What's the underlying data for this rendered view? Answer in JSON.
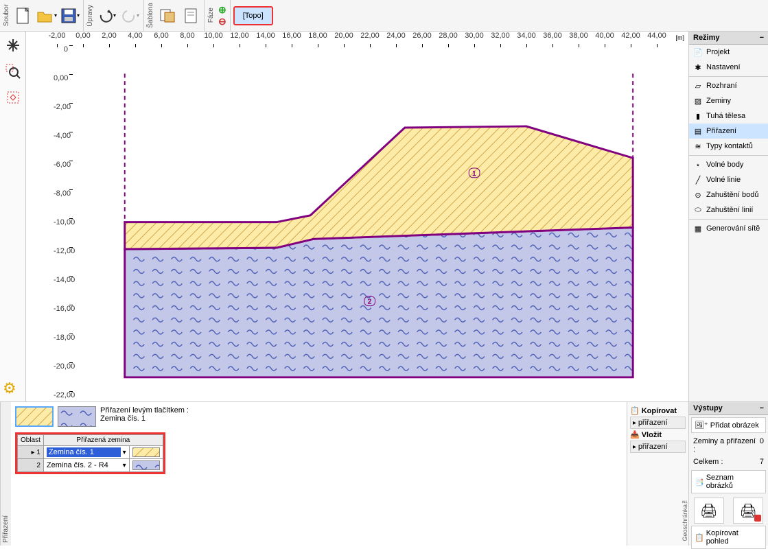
{
  "toolbar": {
    "labels": {
      "soubor": "Soubor",
      "upravy": "Úpravy",
      "sablona": "Šablona",
      "faze": "Fáze"
    },
    "topo": "[Topo]"
  },
  "ruler_unit": "[m]",
  "ruler_x": [
    "-2,00",
    "0,00",
    "2,00",
    "4,00",
    "6,00",
    "8,00",
    "10,00",
    "12,00",
    "14,00",
    "16,00",
    "18,00",
    "20,00",
    "22,00",
    "24,00",
    "26,00",
    "28,00",
    "30,00",
    "32,00",
    "34,00",
    "36,00",
    "38,00",
    "40,00",
    "42,00",
    "44,00"
  ],
  "ruler_y": [
    "0",
    "0,00",
    "-2,00",
    "-4,00",
    "-6,00",
    "-8,00",
    "-10,00",
    "-12,00",
    "-14,00",
    "-16,00",
    "-18,00",
    "-20,00",
    "-22,00"
  ],
  "region_labels": {
    "r1": "1",
    "r2": "2"
  },
  "right": {
    "header": "Režimy",
    "items": [
      {
        "label": "Projekt"
      },
      {
        "label": "Nastavení"
      },
      {
        "sep": true
      },
      {
        "label": "Rozhraní"
      },
      {
        "label": "Zeminy"
      },
      {
        "label": "Tuhá tělesa"
      },
      {
        "label": "Přiřazení",
        "active": true
      },
      {
        "label": "Typy kontaktů"
      },
      {
        "sep": true
      },
      {
        "label": "Volné body"
      },
      {
        "label": "Volné linie"
      },
      {
        "label": "Zahuštění bodů"
      },
      {
        "label": "Zahuštění linií"
      },
      {
        "sep": true
      },
      {
        "label": "Generování sítě"
      }
    ]
  },
  "bottom": {
    "panel_label": "Přiřazení",
    "hint_l1": "Přiřazení levým tlačítkem :",
    "hint_l2": "Zemina čís. 1",
    "th_oblast": "Oblast",
    "th_zemina": "Přiřazená zemina",
    "rows": [
      {
        "n": "1",
        "soil": "Zemina čís. 1",
        "sel": true
      },
      {
        "n": "2",
        "soil": "Zemina čís. 2 - R4",
        "sel": false
      }
    ]
  },
  "clipboard": {
    "label": "Geoschránka™",
    "copy": "Kopírovat",
    "paste": "Vložit",
    "btn": "přiřazení"
  },
  "outputs": {
    "header": "Výstupy",
    "add_img": "Přidat obrázek",
    "row1_l": "Zeminy a přiřazení :",
    "row1_v": "0",
    "row2_l": "Celkem :",
    "row2_v": "7",
    "list": "Seznam obrázků",
    "copy_view": "Kopírovat pohled"
  }
}
